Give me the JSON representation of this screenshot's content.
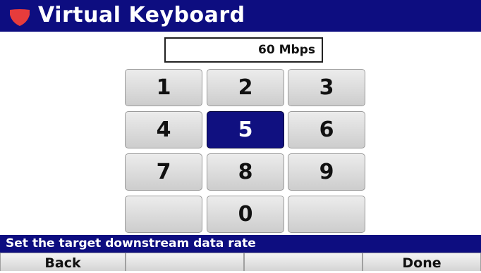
{
  "header": {
    "title": "Virtual Keyboard",
    "icon": "shield-icon",
    "accent_color": "#e63c3c"
  },
  "input": {
    "value": "60 Mbps"
  },
  "keypad": {
    "keys": [
      "1",
      "2",
      "3",
      "4",
      "5",
      "6",
      "7",
      "8",
      "9",
      "",
      "0",
      ""
    ],
    "selected": "5"
  },
  "status": {
    "message": "Set the target downstream data rate"
  },
  "softkeys": [
    "Back",
    "",
    "",
    "Done"
  ],
  "colors": {
    "bar": "#0d0d80",
    "selected_key": "#101080"
  }
}
